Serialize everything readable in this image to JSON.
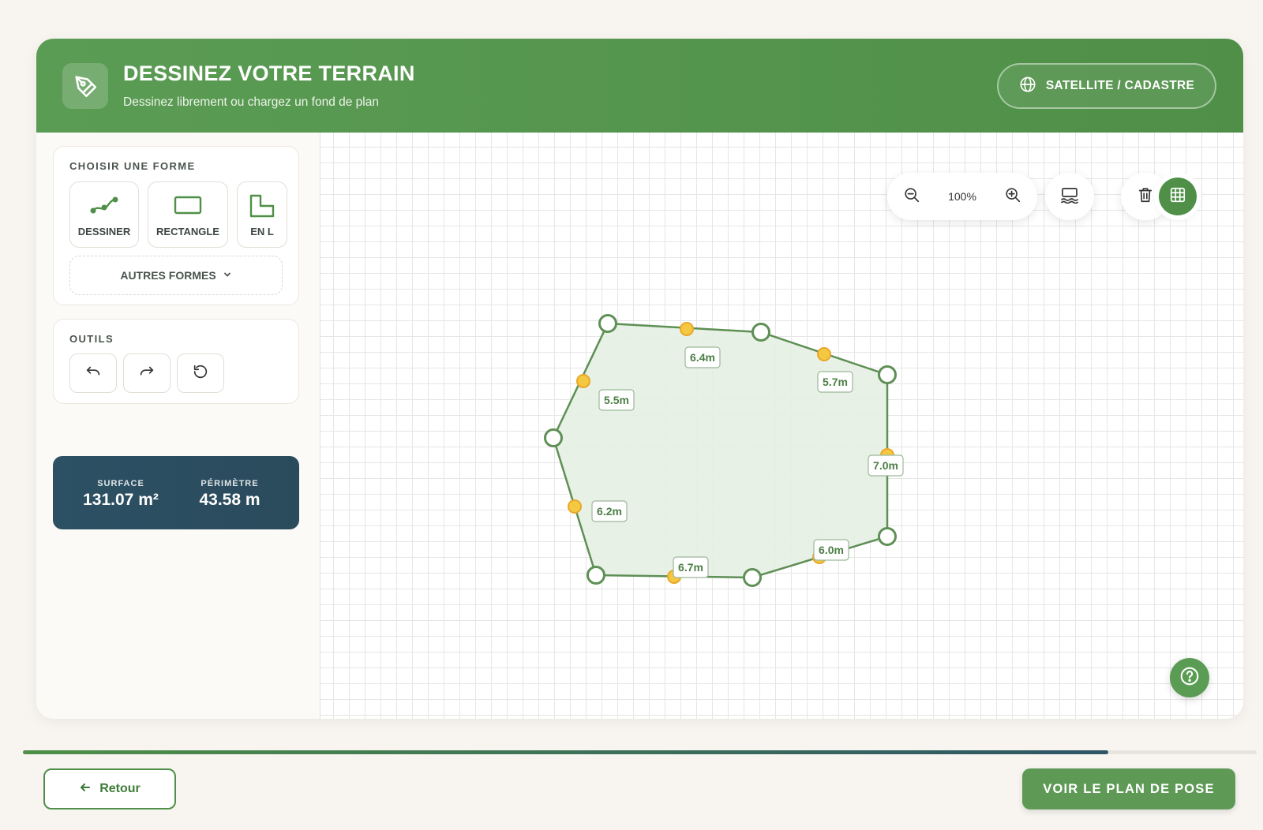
{
  "header": {
    "title": "DESSINEZ VOTRE TERRAIN",
    "subtitle": "Dessinez librement ou chargez un fond de plan",
    "icon": "pen-tool-icon",
    "map_toggle_label": "SATELLITE / CADASTRE",
    "map_toggle_icon": "globe-icon"
  },
  "sidebar": {
    "shapes_title": "CHOISIR UNE FORME",
    "shapes": [
      {
        "label": "DESSINER",
        "icon": "freehand-icon"
      },
      {
        "label": "RECTANGLE",
        "icon": "rectangle-icon"
      },
      {
        "label": "EN L",
        "icon": "l-shape-icon"
      }
    ],
    "more_shapes_label": "AUTRES FORMES",
    "tools_title": "OUTILS",
    "tools": [
      {
        "icon": "undo-icon"
      },
      {
        "icon": "redo-icon"
      },
      {
        "icon": "reset-icon"
      }
    ],
    "stats": {
      "surface_label": "SURFACE",
      "surface_value": "131.07 m²",
      "perimeter_label": "PÉRIMÈTRE",
      "perimeter_value": "43.58 m"
    }
  },
  "canvas": {
    "zoom_label": "100%",
    "polygon": {
      "fill": "#e6efe2",
      "stroke": "#5e8f55",
      "midpoint_color": "#f5c842",
      "edges": [
        {
          "label": "6.4m"
        },
        {
          "label": "5.7m"
        },
        {
          "label": "7.0m"
        },
        {
          "label": "6.0m"
        },
        {
          "label": "6.7m"
        },
        {
          "label": "6.2m"
        },
        {
          "label": "5.5m"
        }
      ]
    }
  },
  "footer": {
    "back_label": "Retour",
    "next_label": "VOIR LE PLAN DE POSE",
    "progress": 0.88
  },
  "colors": {
    "primary": "#4f8f47",
    "stats_bg": "#2c5064",
    "background": "#f8f5f1"
  }
}
